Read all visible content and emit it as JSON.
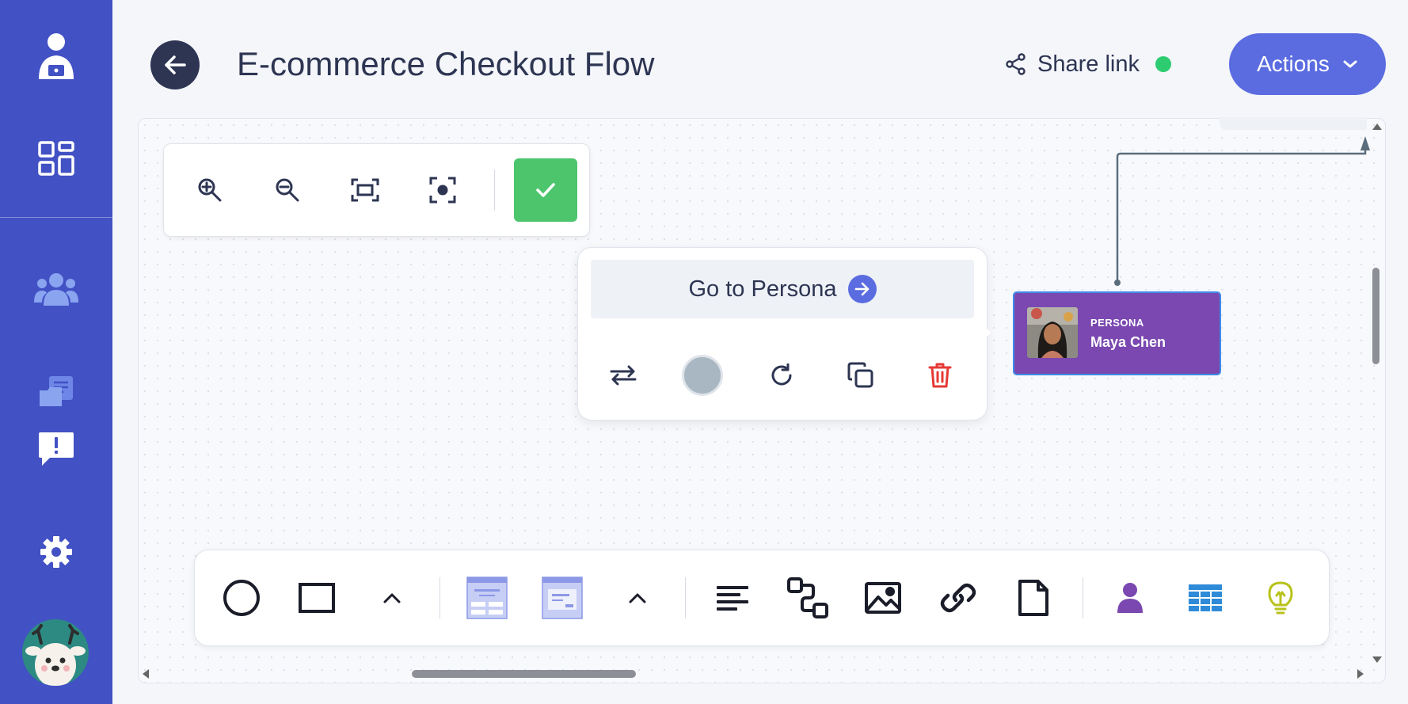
{
  "header": {
    "title": "E-commerce Checkout Flow",
    "share_label": "Share link",
    "actions_label": "Actions"
  },
  "colors": {
    "sidebar": "#4251c4",
    "accent": "#5b6ce0",
    "confirm": "#4cc56d",
    "persona_card": "#7a48b0",
    "status_online": "#2ecc71",
    "danger": "#e53935"
  },
  "sidebar": {
    "icons": [
      "user-laptop-icon",
      "dashboard-icon",
      "team-icon",
      "documents-icon",
      "feedback-icon",
      "settings-icon"
    ]
  },
  "zoom_toolbar": {
    "icons": [
      "zoom-in-icon",
      "zoom-out-icon",
      "fit-screen-icon",
      "center-focus-icon",
      "check-icon"
    ]
  },
  "popover": {
    "goto_label": "Go to Persona",
    "icons": [
      "swap-icon",
      "color-swatch",
      "rotate-icon",
      "duplicate-icon",
      "trash-icon"
    ]
  },
  "persona_node": {
    "type": "PERSONA",
    "name": "Maya Chen"
  },
  "shape_toolbar": {
    "icons": [
      "circle-icon",
      "rectangle-icon",
      "chevron-up-icon",
      "wireframe-page-icon",
      "wireframe-modal-icon",
      "chevron-up-icon",
      "text-align-icon",
      "flow-icon",
      "image-icon",
      "link-icon",
      "document-icon",
      "persona-icon",
      "table-icon",
      "idea-bulb-icon"
    ]
  }
}
